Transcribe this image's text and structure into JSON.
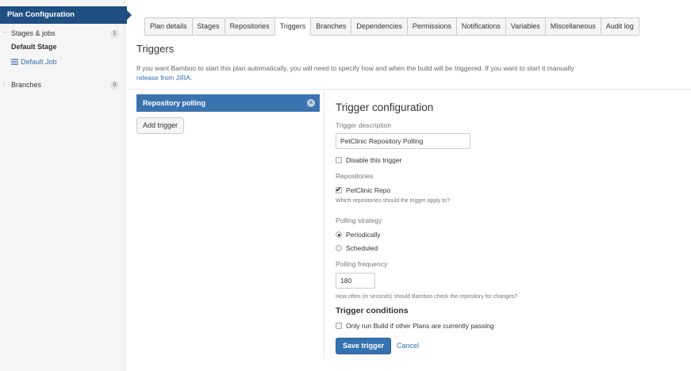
{
  "sidebar": {
    "header": "Plan Configuration",
    "stages_jobs": {
      "label": "Stages & jobs",
      "count": "1"
    },
    "default_stage": "Default Stage",
    "default_job": "Default Job",
    "branches": {
      "label": "Branches",
      "count": "0"
    }
  },
  "tabs": [
    "Plan details",
    "Stages",
    "Repositories",
    "Triggers",
    "Branches",
    "Dependencies",
    "Permissions",
    "Notifications",
    "Variables",
    "Miscellaneous",
    "Audit log"
  ],
  "active_tab": "Triggers",
  "page": {
    "title": "Triggers",
    "intro": "If you want Bamboo to start this plan automatically, you will need to specify how and when the build will be triggered. If you want to start it manually",
    "intro_link": "release from JIRA."
  },
  "trigger_list": {
    "items": [
      {
        "label": "Repository polling"
      }
    ],
    "add_button": "Add trigger"
  },
  "config": {
    "title": "Trigger configuration",
    "description_label": "Trigger description",
    "description_value": "PetClinic Repository Polling",
    "disable_label": "Disable this trigger",
    "disable_checked": false,
    "repositories_label": "Repositories",
    "repo_name": "PetClinic Repo",
    "repo_checked": true,
    "repo_hint": "Which repositories should the trigger apply to?",
    "strategy_label": "Polling strategy",
    "strategy_options": [
      "Periodically",
      "Scheduled"
    ],
    "strategy_selected": "Periodically",
    "frequency_label": "Polling frequency",
    "frequency_value": "180",
    "frequency_hint": "How often (in seconds) should Bamboo check the repository for changes?",
    "conditions_heading": "Trigger conditions",
    "conditions_option": "Only run Build if other Plans are currently passing",
    "conditions_checked": false,
    "save_button": "Save trigger",
    "cancel_link": "Cancel"
  },
  "colors": {
    "accent": "#205081",
    "selected_item": "#3b73af",
    "link": "#3572b0"
  }
}
